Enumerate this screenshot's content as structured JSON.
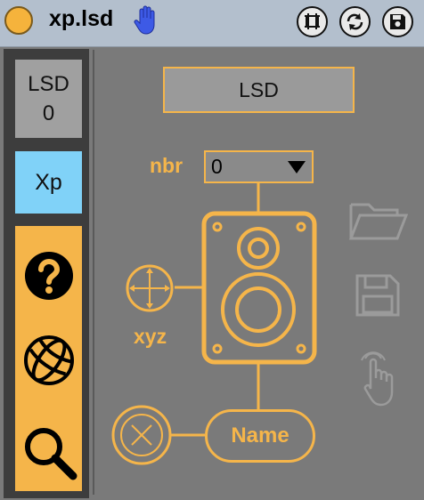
{
  "window": {
    "title": "xp.lsd"
  },
  "sidebar": {
    "lsd_label": "LSD",
    "lsd_value": "0",
    "xp_label": "Xp"
  },
  "panel": {
    "lsd_button_label": "LSD",
    "nbr_label": "nbr",
    "nbr_value": "0",
    "xyz_label": "xyz",
    "name_label": "Name"
  },
  "colors": {
    "accent": "#f5b54a",
    "xp_blue": "#80d2f8",
    "background": "#7a7a7a",
    "titlebar": "#b3bfcd"
  },
  "icons": [
    "hand-icon",
    "present-icon",
    "refresh-icon",
    "save-icon",
    "help-icon",
    "globe-icon",
    "search-icon",
    "folder-icon",
    "disk-icon",
    "pointer-icon",
    "speaker-icon",
    "xyz-crosshair-icon",
    "clear-x-icon"
  ]
}
